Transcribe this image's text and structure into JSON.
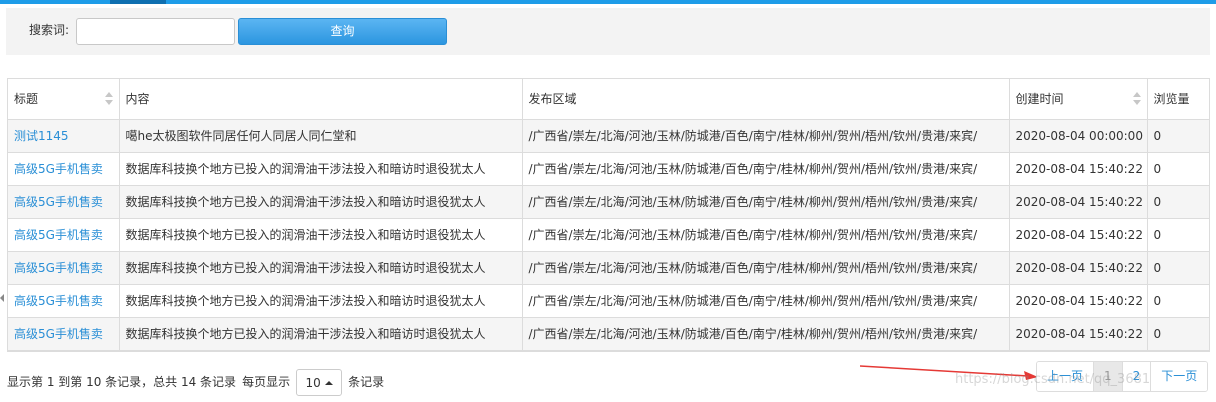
{
  "search": {
    "label": "搜索词:",
    "input_value": "",
    "placeholder": "",
    "button_label": "查询"
  },
  "table": {
    "headers": [
      "标题",
      "内容",
      "发布区域",
      "创建时间",
      "浏览量"
    ],
    "rows": [
      {
        "title": "测试1145",
        "content": "噶he太极图软件同居任何人同居人同仁堂和",
        "region": "/广西省/崇左/北海/河池/玉林/防城港/百色/南宁/桂林/柳州/贺州/梧州/钦州/贵港/来宾/",
        "created": "2020-08-04 00:00:00",
        "views": "0"
      },
      {
        "title": "高级5G手机售卖",
        "content": "数据库科技换个地方已投入的润滑油干涉法投入和暗访时退役犹太人",
        "region": "/广西省/崇左/北海/河池/玉林/防城港/百色/南宁/桂林/柳州/贺州/梧州/钦州/贵港/来宾/",
        "created": "2020-08-04 15:40:22",
        "views": "0"
      },
      {
        "title": "高级5G手机售卖",
        "content": "数据库科技换个地方已投入的润滑油干涉法投入和暗访时退役犹太人",
        "region": "/广西省/崇左/北海/河池/玉林/防城港/百色/南宁/桂林/柳州/贺州/梧州/钦州/贵港/来宾/",
        "created": "2020-08-04 15:40:22",
        "views": "0"
      },
      {
        "title": "高级5G手机售卖",
        "content": "数据库科技换个地方已投入的润滑油干涉法投入和暗访时退役犹太人",
        "region": "/广西省/崇左/北海/河池/玉林/防城港/百色/南宁/桂林/柳州/贺州/梧州/钦州/贵港/来宾/",
        "created": "2020-08-04 15:40:22",
        "views": "0"
      },
      {
        "title": "高级5G手机售卖",
        "content": "数据库科技换个地方已投入的润滑油干涉法投入和暗访时退役犹太人",
        "region": "/广西省/崇左/北海/河池/玉林/防城港/百色/南宁/桂林/柳州/贺州/梧州/钦州/贵港/来宾/",
        "created": "2020-08-04 15:40:22",
        "views": "0"
      },
      {
        "title": "高级5G手机售卖",
        "content": "数据库科技换个地方已投入的润滑油干涉法投入和暗访时退役犹太人",
        "region": "/广西省/崇左/北海/河池/玉林/防城港/百色/南宁/桂林/柳州/贺州/梧州/钦州/贵港/来宾/",
        "created": "2020-08-04 15:40:22",
        "views": "0"
      },
      {
        "title": "高级5G手机售卖",
        "content": "数据库科技换个地方已投入的润滑油干涉法投入和暗访时退役犹太人",
        "region": "/广西省/崇左/北海/河池/玉林/防城港/百色/南宁/桂林/柳州/贺州/梧州/钦州/贵港/来宾/",
        "created": "2020-08-04 15:40:22",
        "views": "0"
      }
    ]
  },
  "pager": {
    "info_prefix": "显示第 1 到第 10 条记录，总共 14 条记录",
    "per_page_label": "每页显示",
    "page_size": "10",
    "records_suffix": "条记录",
    "prev": "上一页",
    "pages": [
      "1",
      "2"
    ],
    "next": "下一页",
    "active_page": "1"
  },
  "watermark": "https://blog.csdn.net/qq_3681",
  "colors": {
    "accent": "#1e9ce8",
    "link": "#2a8fd6",
    "annotation_arrow": "#e53935"
  },
  "icons": [
    "sort-icon",
    "caret-up-icon",
    "red-arrow-annotation"
  ]
}
